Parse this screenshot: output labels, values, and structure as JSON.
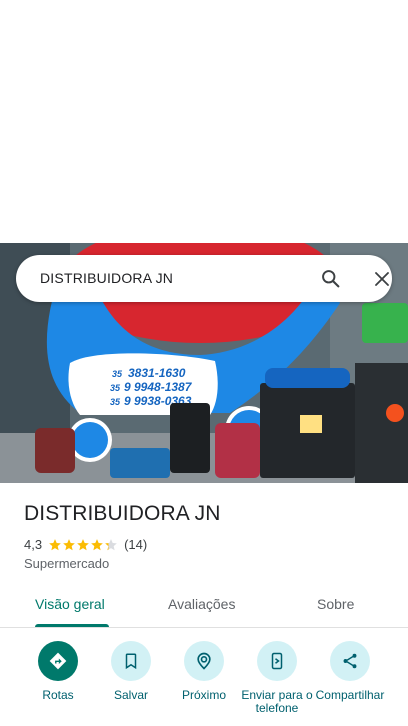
{
  "search": {
    "query": "DISTRIBUIDORA JN",
    "search_icon": "search-icon",
    "close_icon": "close-icon"
  },
  "photo": {
    "phone_lines": [
      {
        "ddd": "35",
        "number": "3831-1630"
      },
      {
        "ddd": "35",
        "number": "9 9948-1387"
      },
      {
        "ddd": "35",
        "number": "9 9938-0363"
      }
    ]
  },
  "place": {
    "name": "DISTRIBUIDORA JN",
    "rating": "4,3",
    "rating_value": 4.3,
    "rating_max": 5,
    "reviews_count": "(14)",
    "category": "Supermercado"
  },
  "tabs": [
    {
      "label": "Visão geral",
      "active": true
    },
    {
      "label": "Avaliações",
      "active": false
    },
    {
      "label": "Sobre",
      "active": false
    }
  ],
  "actions": [
    {
      "label": "Rotas",
      "icon": "directions-icon"
    },
    {
      "label": "Salvar",
      "icon": "bookmark-icon"
    },
    {
      "label": "Próximo",
      "icon": "nearby-icon"
    },
    {
      "label": "Enviar para o telefone",
      "icon": "send-to-phone-icon"
    },
    {
      "label": "Compartilhar",
      "icon": "share-icon"
    }
  ],
  "colors": {
    "accent": "#00796b",
    "action_circle": "#d2f1f5",
    "star": "#fbbc04"
  }
}
